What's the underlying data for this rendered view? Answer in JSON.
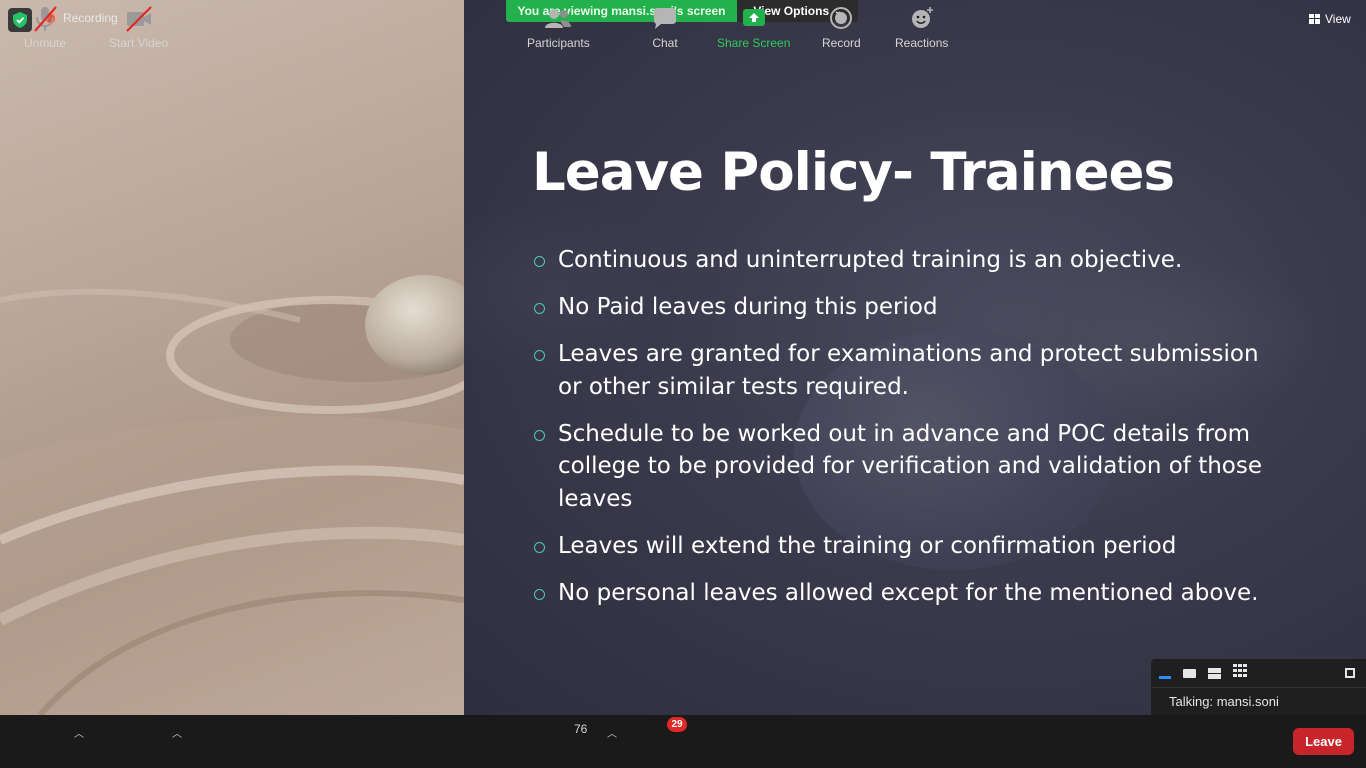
{
  "top": {
    "recording_label": "Recording",
    "viewing_banner": "You are viewing mansi.soni's screen",
    "view_options_label": "View Options",
    "view_label": "View"
  },
  "slide": {
    "title": "Leave Policy- Trainees",
    "bullets": [
      "Continuous and uninterrupted training is an objective.",
      "No Paid leaves during this period",
      "Leaves are granted for examinations and protect submission or other similar tests required.",
      "Schedule to be worked out in advance and POC details from college to be provided for verification and validation of those leaves",
      "Leaves will extend the training or confirmation period",
      "No personal leaves allowed except for the mentioned above."
    ]
  },
  "mini_panel": {
    "talking_label": "Talking: mansi.soni"
  },
  "toolbar": {
    "unmute": "Unmute",
    "start_video": "Start Video",
    "participants": "Participants",
    "participants_count": "76",
    "chat": "Chat",
    "chat_badge": "29",
    "share_screen": "Share Screen",
    "record": "Record",
    "reactions": "Reactions",
    "leave": "Leave"
  },
  "colors": {
    "share_green": "#22b14c",
    "leave_red": "#c8252b",
    "bullet_accent": "#4fc7b5",
    "badge_red": "#e02828"
  }
}
